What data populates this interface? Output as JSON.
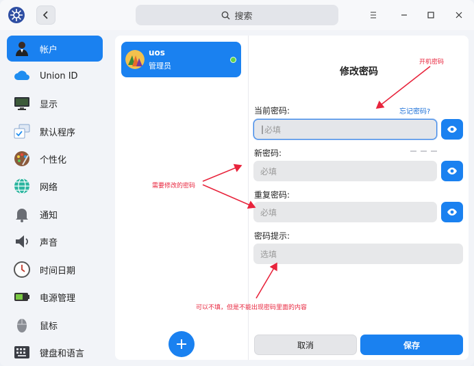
{
  "titlebar": {
    "search_placeholder": "搜索"
  },
  "sidebar": {
    "items": [
      {
        "label": "帐户",
        "icon": "user-account-icon",
        "active": true
      },
      {
        "label": "Union ID",
        "icon": "cloud-icon",
        "active": false
      },
      {
        "label": "显示",
        "icon": "monitor-icon",
        "active": false
      },
      {
        "label": "默认程序",
        "icon": "default-apps-icon",
        "active": false
      },
      {
        "label": "个性化",
        "icon": "palette-icon",
        "active": false
      },
      {
        "label": "网络",
        "icon": "network-globe-icon",
        "active": false
      },
      {
        "label": "通知",
        "icon": "bell-icon",
        "active": false
      },
      {
        "label": "声音",
        "icon": "speaker-icon",
        "active": false
      },
      {
        "label": "时间日期",
        "icon": "clock-icon",
        "active": false
      },
      {
        "label": "电源管理",
        "icon": "battery-icon",
        "active": false
      },
      {
        "label": "鼠标",
        "icon": "mouse-icon",
        "active": false
      },
      {
        "label": "键盘和语言",
        "icon": "keyboard-icon",
        "active": false
      }
    ]
  },
  "account": {
    "name": "uos",
    "role": "管理员"
  },
  "form": {
    "title": "修改密码",
    "current_label": "当前密码:",
    "forgot_link": "忘记密码?",
    "current_placeholder": "必填",
    "new_label": "新密码:",
    "new_placeholder": "必填",
    "repeat_label": "重复密码:",
    "repeat_placeholder": "必填",
    "hint_label": "密码提示:",
    "hint_placeholder": "选填",
    "cancel_label": "取消",
    "save_label": "保存"
  },
  "annotations": {
    "boot_password": "开机密码",
    "need_modify": "需要修改的密码",
    "hint_note": "可以不填，但是不能出现密码里面的内容"
  },
  "colors": {
    "accent": "#1a81f0",
    "annotation": "#e8243c",
    "online": "#63d24a"
  }
}
